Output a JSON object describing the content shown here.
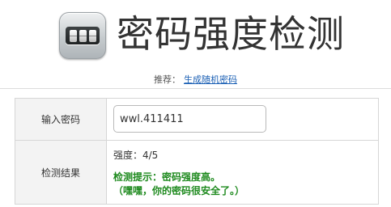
{
  "header": {
    "title": "密码强度检测",
    "logo_icon": "password-lock-icon"
  },
  "recommend": {
    "prefix": "推荐：",
    "link_label": "生成随机密码"
  },
  "form": {
    "password_label": "输入密码",
    "password_value": "wwl.411411",
    "result_label": "检测结果",
    "strength_text": "强度：4/5",
    "tip_line1": "检测提示：密码强度高。",
    "tip_line2": "（嘿嘿，你的密码很安全了。）"
  },
  "colors": {
    "link": "#1a5fb4",
    "tip": "#1e8a1e",
    "label_bg": "#f3f3f3",
    "border": "#d6d6d6"
  }
}
